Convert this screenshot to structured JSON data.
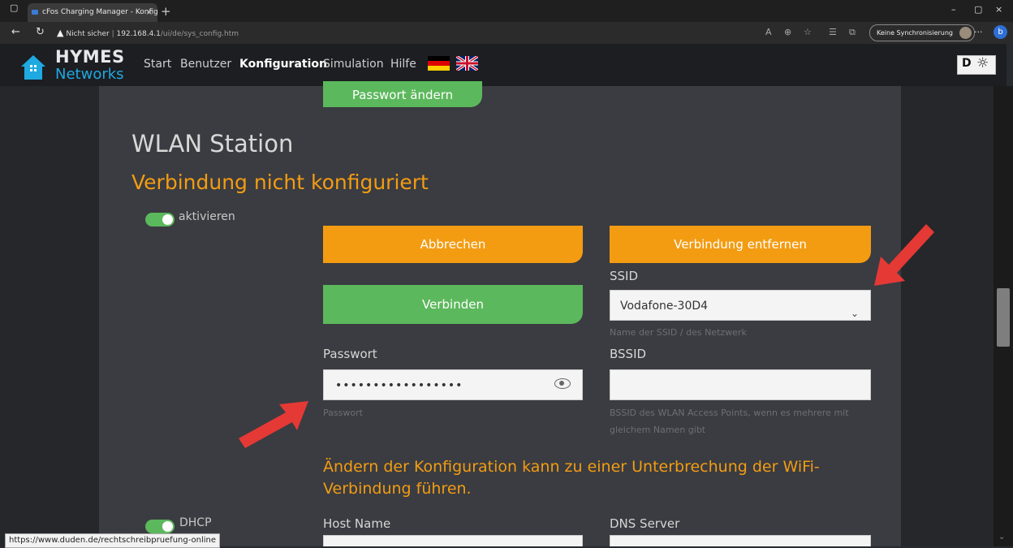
{
  "browser": {
    "tab_title": "cFos Charging Manager - Konfig",
    "tab_close": "×",
    "new_tab": "+",
    "security_label": "Nicht sicher",
    "url_host": "192.168.4.1",
    "url_path": "/ui/de/sys_config.htm",
    "sync_label": "Keine Synchronisierung",
    "more": "···",
    "bing": "b",
    "window_minimize": "–",
    "window_restore": "▢",
    "window_close": "×"
  },
  "header": {
    "logo_line1": "HYMES",
    "logo_line2": "Networks",
    "nav": [
      "Start",
      "Benutzer",
      "Konfiguration",
      "Simulation",
      "Hilfe"
    ],
    "active_nav": "Konfiguration",
    "theme_dark": "D",
    "theme_light": "☼"
  },
  "wlan": {
    "change_password_button": "Passwort ändern",
    "section_title": "WLAN Station",
    "status": "Verbindung nicht konfiguriert",
    "enable_label": "aktivieren",
    "cancel_button": "Abbrechen",
    "remove_connection_button": "Verbindung entfernen",
    "connect_button": "Verbinden",
    "ssid_label": "SSID",
    "ssid_value": "Vodafone-30D4",
    "ssid_hint": "Name der SSID / des Netzwerk",
    "password_label": "Passwort",
    "password_value": "•••••••••••••••••",
    "password_hint": "Passwort",
    "bssid_label": "BSSID",
    "bssid_value": "",
    "bssid_hint": "BSSID des WLAN Access Points, wenn es mehrere mit gleichem Namen gibt",
    "warning": "Ändern der Konfiguration kann zu einer Unterbrechung der WiFi-Verbindung führen.",
    "dhcp_label": "DHCP",
    "host_name_label": "Host Name",
    "dns_server_label": "DNS Server"
  },
  "status_bar_url": "https://www.duden.de/rechtschreibpruefung-online",
  "colors": {
    "accent_orange": "#f39c12",
    "accent_green": "#5cb85c",
    "logo_blue": "#1fa9e1",
    "annotation_red": "#e53935"
  }
}
